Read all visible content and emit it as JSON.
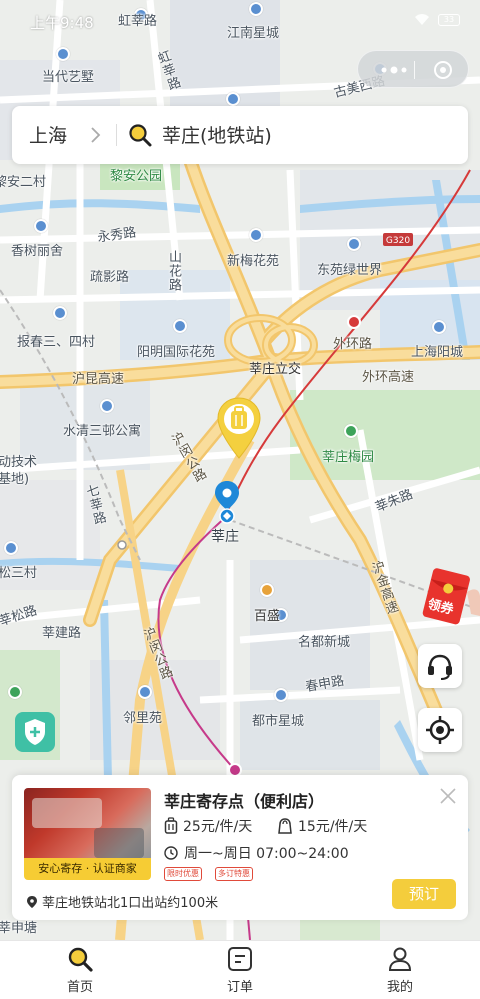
{
  "status_bar": {
    "time": "上午9:48",
    "battery": "33"
  },
  "search": {
    "city": "上海",
    "query": "莘庄(地铁站)"
  },
  "map": {
    "labels": [
      "虹莘路",
      "江南星城",
      "当代艺墅",
      "古美西路",
      "虹莘路",
      "黎安二村",
      "黎安公园",
      "永秀路",
      "香树丽舍",
      "新梅花苑",
      "G320",
      "东苑绿世界",
      "疏影路",
      "山花路",
      "报春三、四村",
      "阳明国际花苑",
      "外环路",
      "上海阳城",
      "沪昆高速",
      "莘庄立交",
      "外环高速",
      "水清三邨公寓",
      "动技术",
      "基地)",
      "沪闵公路",
      "莘庄梅园",
      "七莘路",
      "莘庄",
      "莘朱路",
      "松三村",
      "百盛",
      "莘松路",
      "莘建路",
      "沪金高速",
      "名都新城",
      "沪闵公路",
      "春申路",
      "邻里苑",
      "都市星城",
      "莘申塘"
    ]
  },
  "card": {
    "title": "莘庄寄存点（便利店）",
    "badge": "安心寄存 · 认证商家",
    "price_luggage": "25元/件/天",
    "price_bag": "15元/件/天",
    "hours": "周一~周日 07:00~24:00",
    "tag_limited": "限时优惠",
    "tag_multi": "多订特惠",
    "address": "莘庄地铁站北1口出站约100米",
    "book_label": "预订"
  },
  "coupon_label": "领券",
  "tabs": [
    {
      "label": "首页"
    },
    {
      "label": "订单"
    },
    {
      "label": "我的"
    }
  ],
  "colors": {
    "accent": "#f4cd3c",
    "highway": "#f7d387",
    "water": "#a9d2f0",
    "green": "#bfe3b4"
  }
}
